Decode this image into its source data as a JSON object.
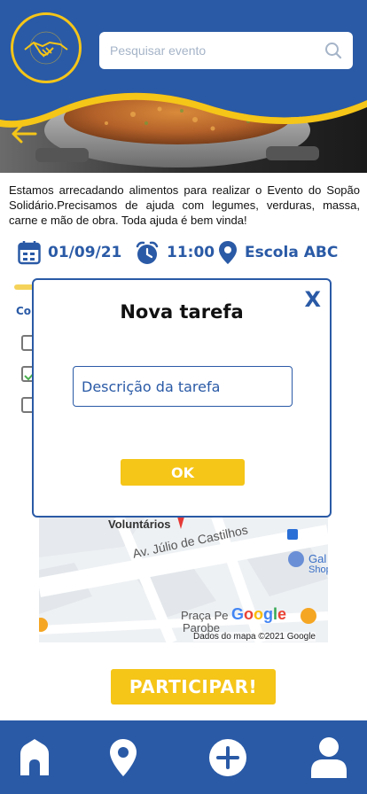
{
  "colors": {
    "primary": "#2a5aa6",
    "accent": "#f5c518",
    "background": "#ffffff"
  },
  "search": {
    "placeholder": "Pesquisar evento",
    "icon": "search-icon"
  },
  "event": {
    "description": "Estamos arrecadando alimentos para realizar o Evento do Sopão Solidário.Precisamos de ajuda com legumes, verduras, massa, carne e mão de obra. Toda ajuda é bem vinda!",
    "date": "01/09/21",
    "time": "11:00",
    "location": "Escola ABC"
  },
  "background_list": {
    "partial_heading": "Co"
  },
  "map": {
    "labels": {
      "voluntarios": "Voluntários",
      "street": "Av. Júlio de Castilhos",
      "square": "Praça Pe",
      "square2": "Parobe",
      "shop": "Gal",
      "shop2": "Shop"
    },
    "google": "Google",
    "attribution": "Dados do mapa ©2021 Google"
  },
  "participate_label": "PARTICIPAR!",
  "modal": {
    "title": "Nova tarefa",
    "close_label": "X",
    "input_placeholder": "Descrição da tarefa",
    "ok_label": "OK"
  },
  "nav": [
    "home-icon",
    "location-icon",
    "add-icon",
    "profile-icon"
  ]
}
